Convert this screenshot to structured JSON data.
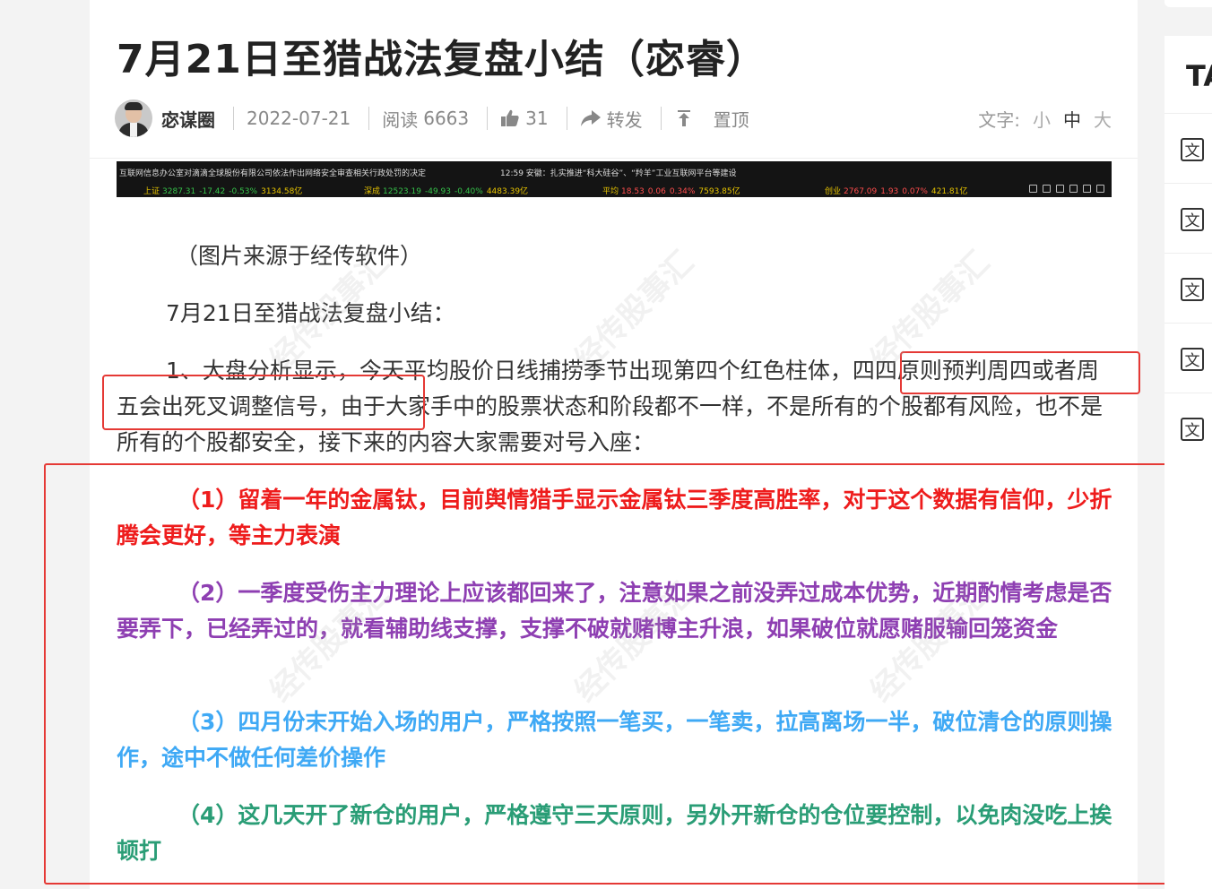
{
  "article": {
    "title": "7月21日至猎战法复盘小结（宓睿）",
    "author": "宓谋圈",
    "date": "2022-07-21",
    "reads_label": "阅读",
    "reads": "6663",
    "likes": "31",
    "share_label": "转发",
    "pin_label": "置顶",
    "font_label": "文字:",
    "font_small": "小",
    "font_medium": "中",
    "font_large": "大"
  },
  "ticker": {
    "news1": "互联网信息办公室对滴滴全球股份有限公司依法作出网络安全审查相关行政处罚的决定",
    "news2": "12:59 安徽：扎实推进“科大硅谷”、“羚羊”工业互联网平台等建设",
    "indices": [
      {
        "name": "上证",
        "value": "3287.31",
        "change": "-17.42",
        "pct": "-0.53%",
        "amount": "3134.58亿",
        "dir": "dn"
      },
      {
        "name": "深成",
        "value": "12523.19",
        "change": "-49.93",
        "pct": "-0.40%",
        "amount": "4483.39亿",
        "dir": "dn"
      },
      {
        "name": "平均",
        "value": "18.53",
        "change": "0.06",
        "pct": "0.34%",
        "amount": "7593.85亿",
        "dir": "up"
      },
      {
        "name": "创业",
        "value": "2767.09",
        "change": "1.93",
        "pct": "0.07%",
        "amount": "421.81亿",
        "dir": "up"
      }
    ]
  },
  "content": {
    "caption": "（图片来源于经传软件）",
    "subtitle": "7月21日至猎战法复盘小结：",
    "p1_a": "1、大盘分析显示，今天平均股价日线捕捞季节出现第四个红色柱体，",
    "p1_highlight": "四四原则预判周四或者周五会出死叉调整信号",
    "p1_b": "，由于大家手中的股票状态和阶段都不一样，不是所有的个股都有风险，也不是所有的个股都安全，接下来的内容大家需要对号入座：",
    "point1": "（1）留着一年的金属钛，目前舆情猎手显示金属钛三季度高胜率，对于这个数据有信仰，少折腾会更好，等主力表演",
    "point2": "（2）一季度受伤主力理论上应该都回来了，注意如果之前没弄过成本优势，近期酌情考虑是否要弄下，已经弄过的，就看辅助线支撑，支撑不破就赌博主升浪，如果破位就愿赌服输回笼资金",
    "point3": "（3）四月份末开始入场的用户，严格按照一笔买，一笔卖，拉高离场一半，破位清仓的原则操作，途中不做任何差价操作",
    "point4": "（4）这几天开了新仓的用户，严格遵守三天原则，另外开新仓的仓位要控制，以免肉没吃上挨顿打"
  },
  "sidebar": {
    "title": "TA",
    "doc_icon": "文",
    "items": [
      "文",
      "文",
      "文",
      "文",
      "文"
    ]
  },
  "watermark": "经传股事汇",
  "colors": {
    "point1": "#ee1c1c",
    "point2": "#8e3fb2",
    "point3": "#3fa9f5",
    "point4": "#2a9d76",
    "highlight_box": "#e53935"
  }
}
